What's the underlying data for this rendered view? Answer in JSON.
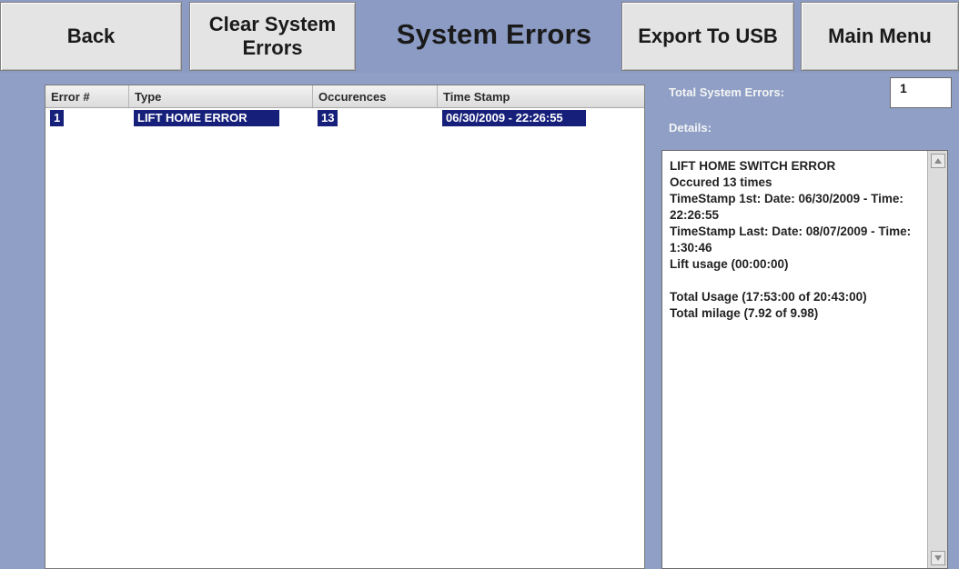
{
  "toolbar": {
    "back_label": "Back",
    "clear_label_line1": "Clear System",
    "clear_label_line2": "Errors",
    "title": "System Errors",
    "export_label": "Export To USB",
    "main_menu_label": "Main Menu"
  },
  "table": {
    "columns": [
      "Error #",
      "Type",
      "Occurences",
      "Time Stamp"
    ],
    "rows": [
      {
        "error_no": "1",
        "type": "LIFT HOME ERROR",
        "occurrences": "13",
        "timestamp": "06/30/2009 - 22:26:55"
      }
    ]
  },
  "summary": {
    "total_label": "Total System Errors:",
    "total_value": "1",
    "details_label": "Details:"
  },
  "details": {
    "lines": [
      "LIFT HOME SWITCH ERROR",
      "Occured 13 times",
      "TimeStamp 1st: Date: 06/30/2009 - Time:",
      "22:26:55",
      "TimeStamp Last: Date: 08/07/2009 - Time:",
      "1:30:46",
      "Lift usage (00:00:00)",
      "",
      "Total Usage (17:53:00 of 20:43:00)",
      "Total milage (7.92 of 9.98)"
    ]
  },
  "colors": {
    "background": "#8f9fc6",
    "button": "#e4e4e4",
    "selection": "#16207a"
  }
}
